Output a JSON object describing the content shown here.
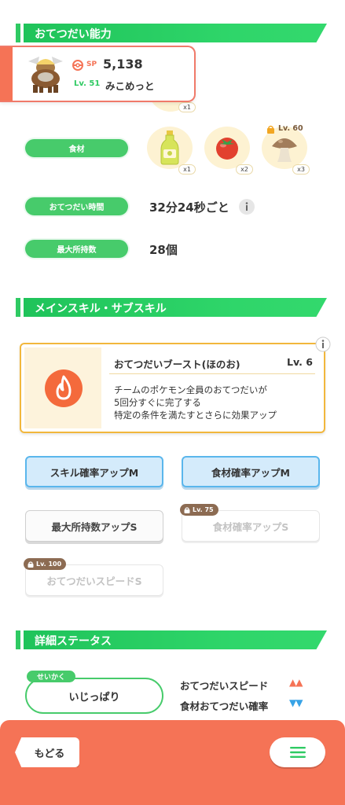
{
  "sections": {
    "help_ability": "おてつだい能力",
    "skills": "メインスキル・サブスキル",
    "details": "詳細ステータス"
  },
  "pokemon": {
    "sp_label": "SP",
    "sp_value": "5,138",
    "level": "Lv. 51",
    "name": "みこめっと",
    "colors": {
      "accent": "#f57356",
      "border": "#f07a6a"
    }
  },
  "stats": {
    "ingredients_label": "食材",
    "partial_qty": "x1",
    "ingredients": [
      {
        "icon": "oil-bottle-icon",
        "qty": "x1"
      },
      {
        "icon": "tomato-icon",
        "qty": "x2"
      },
      {
        "icon": "mushroom-icon",
        "qty": "x3",
        "lock": "Lv. 60"
      }
    ],
    "help_time_label": "おてつだい時間",
    "help_time_value": "32分24秒ごと",
    "max_carry_label": "最大所持数",
    "max_carry_value": "28個"
  },
  "main_skill": {
    "name": "おてつだいブースト(ほのお)",
    "level": "Lv. 6",
    "desc_line1": "チームのポケモン全員のおてつだいが",
    "desc_line2": "5回分すぐに完了する",
    "desc_line3": "特定の条件を満たすとさらに効果アップ",
    "icon": "fire-icon",
    "border_color": "#f2b73c"
  },
  "sub_skills": [
    {
      "label": "スキル確率アップM",
      "state": "active-blue"
    },
    {
      "label": "食材確率アップM",
      "state": "active-blue"
    },
    {
      "label": "最大所持数アップS",
      "state": "active-white"
    },
    {
      "label": "食材確率アップS",
      "state": "locked",
      "lock": "Lv. 75"
    },
    {
      "label": "おてつだいスピードS",
      "state": "locked",
      "lock": "Lv. 100"
    }
  ],
  "nature": {
    "tag": "せいかく",
    "value": "いじっぱり",
    "effects": [
      {
        "label": "おてつだいスピード",
        "arrows": "▲▲",
        "color": "#f57356"
      },
      {
        "label": "食材おてつだい確率",
        "arrows": "▼▼",
        "color": "#38a3e6"
      }
    ]
  },
  "nav": {
    "back": "もどる",
    "menu_icon": "menu-icon"
  },
  "colors": {
    "green": "#2fca63",
    "orange": "#f57356",
    "blue": "#5ab6ec"
  }
}
